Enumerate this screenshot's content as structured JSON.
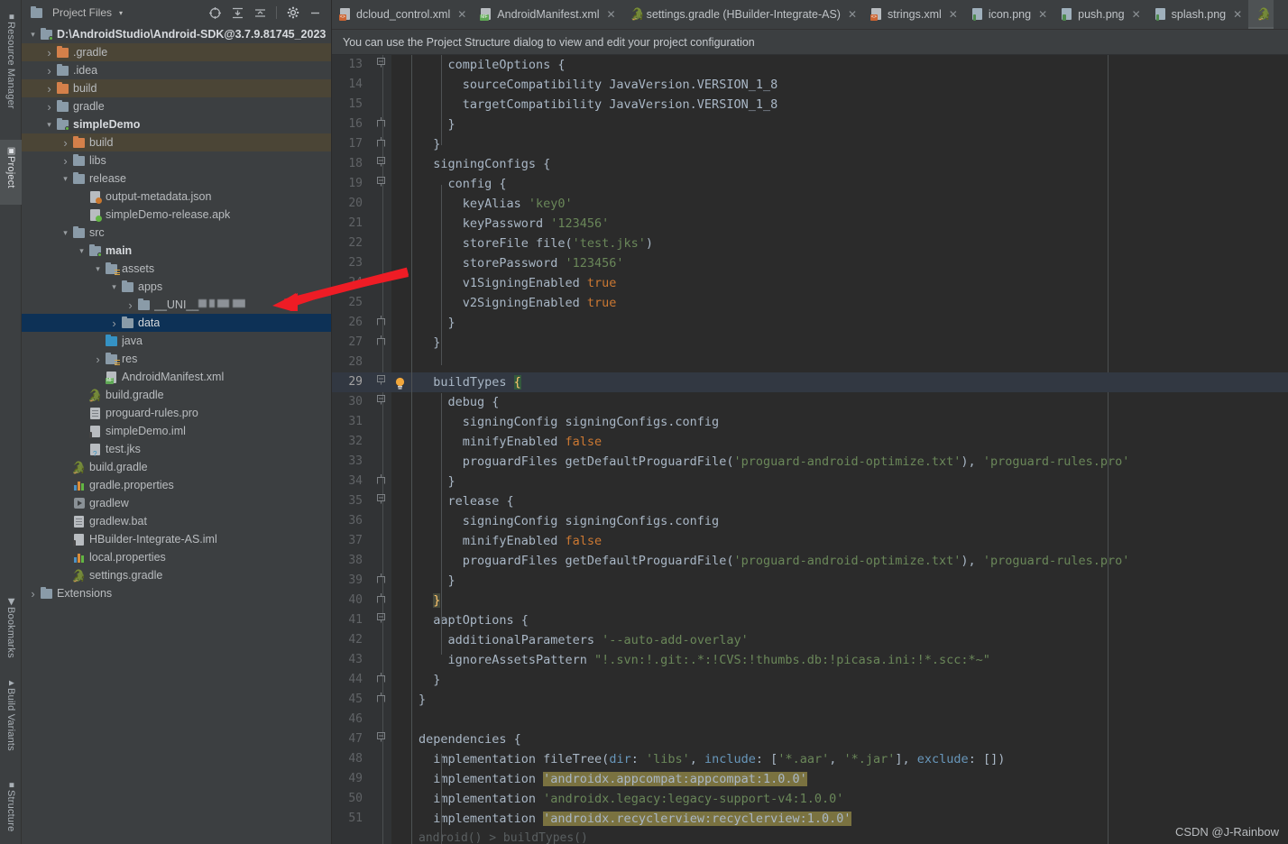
{
  "tool_windows_left": [
    {
      "label": "Resource Manager",
      "icon": "resource-manager-icon",
      "selected": false
    },
    {
      "label": "Project",
      "icon": "project-icon",
      "selected": true
    },
    {
      "label": "Bookmarks",
      "icon": "bookmarks-icon",
      "selected": false
    },
    {
      "label": "Build Variants",
      "icon": "build-variants-icon",
      "selected": false
    },
    {
      "label": "Structure",
      "icon": "structure-icon",
      "selected": false
    }
  ],
  "project_panel": {
    "title": "Project Files",
    "dropdown_caret": "▾",
    "tools": [
      {
        "name": "locate-in-tree-icon",
        "title": "Select Opened File"
      },
      {
        "name": "expand-all-icon",
        "title": "Expand All"
      },
      {
        "name": "collapse-all-icon",
        "title": "Collapse All"
      },
      {
        "name": "gear-icon",
        "title": "Settings"
      },
      {
        "name": "minimize-icon",
        "title": "Hide"
      }
    ],
    "tree": [
      {
        "label": "D:\\AndroidStudio\\Android-SDK@3.7.9.81745_2023",
        "indent": 0,
        "arrow": "down",
        "icon": "folder-module",
        "bold": true,
        "style": "normal"
      },
      {
        "label": ".gradle",
        "indent": 1,
        "arrow": "right",
        "icon": "folder-orange",
        "bold": false,
        "style": "tan"
      },
      {
        "label": ".idea",
        "indent": 1,
        "arrow": "right",
        "icon": "folder-grey",
        "bold": false,
        "style": "normal"
      },
      {
        "label": "build",
        "indent": 1,
        "arrow": "right",
        "icon": "folder-orange",
        "bold": false,
        "style": "tan"
      },
      {
        "label": "gradle",
        "indent": 1,
        "arrow": "right",
        "icon": "folder-grey",
        "bold": false,
        "style": "normal"
      },
      {
        "label": "simpleDemo",
        "indent": 1,
        "arrow": "down",
        "icon": "folder-module",
        "bold": true,
        "style": "normal"
      },
      {
        "label": "build",
        "indent": 2,
        "arrow": "right",
        "icon": "folder-orange",
        "bold": false,
        "style": "tan"
      },
      {
        "label": "libs",
        "indent": 2,
        "arrow": "right",
        "icon": "folder-grey",
        "bold": false,
        "style": "normal"
      },
      {
        "label": "release",
        "indent": 2,
        "arrow": "down",
        "icon": "folder-grey",
        "bold": false,
        "style": "normal"
      },
      {
        "label": "output-metadata.json",
        "indent": 3,
        "arrow": "none",
        "icon": "json-file",
        "bold": false,
        "style": "normal"
      },
      {
        "label": "simpleDemo-release.apk",
        "indent": 3,
        "arrow": "none",
        "icon": "apk-file",
        "bold": false,
        "style": "normal"
      },
      {
        "label": "src",
        "indent": 2,
        "arrow": "down",
        "icon": "folder-grey",
        "bold": false,
        "style": "normal"
      },
      {
        "label": "main",
        "indent": 3,
        "arrow": "down",
        "icon": "folder-module",
        "bold": true,
        "style": "normal"
      },
      {
        "label": "assets",
        "indent": 4,
        "arrow": "down",
        "icon": "folder-resource",
        "bold": false,
        "style": "normal"
      },
      {
        "label": "apps",
        "indent": 5,
        "arrow": "down",
        "icon": "folder-grey",
        "bold": false,
        "style": "normal"
      },
      {
        "label": "__UNI__",
        "indent": 6,
        "arrow": "right",
        "icon": "folder-grey",
        "bold": false,
        "style": "blurred"
      },
      {
        "label": "data",
        "indent": 5,
        "arrow": "right",
        "icon": "folder-grey",
        "bold": false,
        "style": "selected"
      },
      {
        "label": "java",
        "indent": 4,
        "arrow": "none",
        "icon": "folder-blue",
        "bold": false,
        "style": "normal"
      },
      {
        "label": "res",
        "indent": 4,
        "arrow": "right",
        "icon": "folder-resource",
        "bold": false,
        "style": "normal"
      },
      {
        "label": "AndroidManifest.xml",
        "indent": 4,
        "arrow": "none",
        "icon": "manifest-file",
        "bold": false,
        "style": "normal"
      },
      {
        "label": "build.gradle",
        "indent": 3,
        "arrow": "none",
        "icon": "gradle-file",
        "bold": false,
        "style": "normal"
      },
      {
        "label": "proguard-rules.pro",
        "indent": 3,
        "arrow": "none",
        "icon": "text-file",
        "bold": false,
        "style": "normal"
      },
      {
        "label": "simpleDemo.iml",
        "indent": 3,
        "arrow": "none",
        "icon": "iml-file",
        "bold": false,
        "style": "normal"
      },
      {
        "label": "test.jks",
        "indent": 3,
        "arrow": "none",
        "icon": "unknown-file",
        "bold": false,
        "style": "normal"
      },
      {
        "label": "build.gradle",
        "indent": 2,
        "arrow": "none",
        "icon": "gradle-file",
        "bold": false,
        "style": "normal"
      },
      {
        "label": "gradle.properties",
        "indent": 2,
        "arrow": "none",
        "icon": "properties-file",
        "bold": false,
        "style": "normal"
      },
      {
        "label": "gradlew",
        "indent": 2,
        "arrow": "none",
        "icon": "script-file",
        "bold": false,
        "style": "normal"
      },
      {
        "label": "gradlew.bat",
        "indent": 2,
        "arrow": "none",
        "icon": "text-file",
        "bold": false,
        "style": "normal"
      },
      {
        "label": "HBuilder-Integrate-AS.iml",
        "indent": 2,
        "arrow": "none",
        "icon": "iml-file",
        "bold": false,
        "style": "normal"
      },
      {
        "label": "local.properties",
        "indent": 2,
        "arrow": "none",
        "icon": "properties-file",
        "bold": false,
        "style": "normal"
      },
      {
        "label": "settings.gradle",
        "indent": 2,
        "arrow": "none",
        "icon": "gradle-file",
        "bold": false,
        "style": "normal"
      },
      {
        "label": "Extensions",
        "indent": 0,
        "arrow": "right",
        "icon": "folder-grey",
        "bold": false,
        "style": "normal"
      }
    ]
  },
  "editor": {
    "tabs": [
      {
        "label": "dcloud_control.xml",
        "icon": "xml-file-icon",
        "active": false,
        "closable": true
      },
      {
        "label": "AndroidManifest.xml",
        "icon": "manifest-file-icon",
        "active": false,
        "closable": true
      },
      {
        "label": "settings.gradle (HBuilder-Integrate-AS)",
        "icon": "gradle-file-icon",
        "active": false,
        "closable": true
      },
      {
        "label": "strings.xml",
        "icon": "xml-file-icon",
        "active": false,
        "closable": true
      },
      {
        "label": "icon.png",
        "icon": "image-file-icon",
        "active": false,
        "closable": true
      },
      {
        "label": "push.png",
        "icon": "image-file-icon",
        "active": false,
        "closable": true
      },
      {
        "label": "splash.png",
        "icon": "image-file-icon",
        "active": false,
        "closable": true
      },
      {
        "label": "",
        "icon": "gradle-file-icon",
        "active": true,
        "closable": false
      }
    ],
    "notification": "You can use the Project Structure dialog to view and edit your project configuration",
    "breadcrumb": "android() > buildTypes()",
    "first_line_number": 13,
    "lines": [
      {
        "n": 13,
        "fold": "fold-start",
        "indent": 4,
        "tokens": [
          {
            "t": "compileOptions {",
            "c": "pln"
          }
        ]
      },
      {
        "n": 14,
        "fold": "",
        "indent": 6,
        "tokens": [
          {
            "t": "sourceCompatibility JavaVersion.VERSION_1_8",
            "c": "pln"
          }
        ]
      },
      {
        "n": 15,
        "fold": "",
        "indent": 6,
        "tokens": [
          {
            "t": "targetCompatibility JavaVersion.VERSION_1_8",
            "c": "pln"
          }
        ]
      },
      {
        "n": 16,
        "fold": "fold-end",
        "indent": 4,
        "tokens": [
          {
            "t": "}",
            "c": "pln"
          }
        ]
      },
      {
        "n": 17,
        "fold": "fold-end",
        "indent": 2,
        "tokens": [
          {
            "t": "}",
            "c": "pln"
          }
        ]
      },
      {
        "n": 18,
        "fold": "fold-start",
        "indent": 2,
        "tokens": [
          {
            "t": "signingConfigs {",
            "c": "pln"
          }
        ]
      },
      {
        "n": 19,
        "fold": "fold-start",
        "indent": 4,
        "tokens": [
          {
            "t": "config {",
            "c": "pln"
          }
        ]
      },
      {
        "n": 20,
        "fold": "",
        "indent": 6,
        "tokens": [
          {
            "t": "keyAlias ",
            "c": "pln"
          },
          {
            "t": "'key0'",
            "c": "s"
          }
        ]
      },
      {
        "n": 21,
        "fold": "",
        "indent": 6,
        "tokens": [
          {
            "t": "keyPassword ",
            "c": "pln"
          },
          {
            "t": "'123456'",
            "c": "s"
          }
        ]
      },
      {
        "n": 22,
        "fold": "",
        "indent": 6,
        "tokens": [
          {
            "t": "storeFile file(",
            "c": "pln"
          },
          {
            "t": "'test.jks'",
            "c": "s"
          },
          {
            "t": ")",
            "c": "pln"
          }
        ]
      },
      {
        "n": 23,
        "fold": "",
        "indent": 6,
        "tokens": [
          {
            "t": "storePassword ",
            "c": "pln"
          },
          {
            "t": "'123456'",
            "c": "s"
          }
        ]
      },
      {
        "n": 24,
        "fold": "",
        "indent": 6,
        "tokens": [
          {
            "t": "v1SigningEnabled ",
            "c": "pln"
          },
          {
            "t": "true",
            "c": "k"
          }
        ]
      },
      {
        "n": 25,
        "fold": "",
        "indent": 6,
        "tokens": [
          {
            "t": "v2SigningEnabled ",
            "c": "pln"
          },
          {
            "t": "true",
            "c": "k"
          }
        ]
      },
      {
        "n": 26,
        "fold": "fold-end",
        "indent": 4,
        "tokens": [
          {
            "t": "}",
            "c": "pln"
          }
        ]
      },
      {
        "n": 27,
        "fold": "fold-end",
        "indent": 2,
        "tokens": [
          {
            "t": "}",
            "c": "pln"
          }
        ]
      },
      {
        "n": 28,
        "fold": "",
        "indent": 0,
        "tokens": []
      },
      {
        "n": 29,
        "fold": "fold-start",
        "indent": 2,
        "bulb": true,
        "highlight": true,
        "tokens": [
          {
            "t": "buildTypes ",
            "c": "pln"
          },
          {
            "t": "{",
            "c": "hlb"
          }
        ]
      },
      {
        "n": 30,
        "fold": "fold-start",
        "indent": 4,
        "tokens": [
          {
            "t": "debug {",
            "c": "pln"
          }
        ]
      },
      {
        "n": 31,
        "fold": "",
        "indent": 6,
        "tokens": [
          {
            "t": "signingConfig signingConfigs.config",
            "c": "pln"
          }
        ]
      },
      {
        "n": 32,
        "fold": "",
        "indent": 6,
        "tokens": [
          {
            "t": "minifyEnabled ",
            "c": "pln"
          },
          {
            "t": "false",
            "c": "k"
          }
        ]
      },
      {
        "n": 33,
        "fold": "",
        "indent": 6,
        "tokens": [
          {
            "t": "proguardFiles getDefaultProguardFile(",
            "c": "pln"
          },
          {
            "t": "'proguard-android-optimize.txt'",
            "c": "s"
          },
          {
            "t": "), ",
            "c": "pln"
          },
          {
            "t": "'proguard-rules.pro'",
            "c": "s"
          }
        ]
      },
      {
        "n": 34,
        "fold": "fold-end",
        "indent": 4,
        "tokens": [
          {
            "t": "}",
            "c": "pln"
          }
        ]
      },
      {
        "n": 35,
        "fold": "fold-start",
        "indent": 4,
        "tokens": [
          {
            "t": "release {",
            "c": "pln"
          }
        ]
      },
      {
        "n": 36,
        "fold": "",
        "indent": 6,
        "tokens": [
          {
            "t": "signingConfig signingConfigs.config",
            "c": "pln"
          }
        ]
      },
      {
        "n": 37,
        "fold": "",
        "indent": 6,
        "tokens": [
          {
            "t": "minifyEnabled ",
            "c": "pln"
          },
          {
            "t": "false",
            "c": "k"
          }
        ]
      },
      {
        "n": 38,
        "fold": "",
        "indent": 6,
        "tokens": [
          {
            "t": "proguardFiles getDefaultProguardFile(",
            "c": "pln"
          },
          {
            "t": "'proguard-android-optimize.txt'",
            "c": "s"
          },
          {
            "t": "), ",
            "c": "pln"
          },
          {
            "t": "'proguard-rules.pro'",
            "c": "s"
          }
        ]
      },
      {
        "n": 39,
        "fold": "fold-end",
        "indent": 4,
        "tokens": [
          {
            "t": "}",
            "c": "pln"
          }
        ]
      },
      {
        "n": 40,
        "fold": "fold-end",
        "indent": 2,
        "tokens": [
          {
            "t": "}",
            "c": "hly"
          }
        ]
      },
      {
        "n": 41,
        "fold": "fold-start",
        "indent": 2,
        "tokens": [
          {
            "t": "aaptOptions {",
            "c": "pln"
          }
        ]
      },
      {
        "n": 42,
        "fold": "",
        "indent": 4,
        "tokens": [
          {
            "t": "additionalParameters ",
            "c": "pln"
          },
          {
            "t": "'--auto-add-overlay'",
            "c": "s"
          }
        ]
      },
      {
        "n": 43,
        "fold": "",
        "indent": 4,
        "tokens": [
          {
            "t": "ignoreAssetsPattern ",
            "c": "pln"
          },
          {
            "t": "\"!.svn:!.git:.*:!CVS:!thumbs.db:!picasa.ini:!*.scc:*~\"",
            "c": "s"
          }
        ]
      },
      {
        "n": 44,
        "fold": "fold-end",
        "indent": 2,
        "tokens": [
          {
            "t": "}",
            "c": "pln"
          }
        ]
      },
      {
        "n": 45,
        "fold": "fold-end",
        "indent": 0,
        "tokens": [
          {
            "t": "}",
            "c": "pln"
          }
        ]
      },
      {
        "n": 46,
        "fold": "",
        "indent": 0,
        "tokens": []
      },
      {
        "n": 47,
        "fold": "fold-start",
        "indent": 0,
        "tokens": [
          {
            "t": "dependencies {",
            "c": "pln"
          }
        ]
      },
      {
        "n": 48,
        "fold": "",
        "indent": 2,
        "tokens": [
          {
            "t": "implementation fileTree(",
            "c": "pln"
          },
          {
            "t": "dir",
            "c": "n"
          },
          {
            "t": ": ",
            "c": "pln"
          },
          {
            "t": "'libs'",
            "c": "s"
          },
          {
            "t": ", ",
            "c": "pln"
          },
          {
            "t": "include",
            "c": "n"
          },
          {
            "t": ": [",
            "c": "pln"
          },
          {
            "t": "'*.aar'",
            "c": "s"
          },
          {
            "t": ", ",
            "c": "pln"
          },
          {
            "t": "'*.jar'",
            "c": "s"
          },
          {
            "t": "], ",
            "c": "pln"
          },
          {
            "t": "exclude",
            "c": "n"
          },
          {
            "t": ": [])",
            "c": "pln"
          }
        ]
      },
      {
        "n": 49,
        "fold": "",
        "indent": 2,
        "tokens": [
          {
            "t": "implementation ",
            "c": "pln"
          },
          {
            "t": "'androidx.appcompat:appcompat:1.0.0'",
            "c": "occ"
          }
        ]
      },
      {
        "n": 50,
        "fold": "",
        "indent": 2,
        "tokens": [
          {
            "t": "implementation ",
            "c": "pln"
          },
          {
            "t": "'androidx.legacy:legacy-support-v4:1.0.0'",
            "c": "s"
          }
        ]
      },
      {
        "n": 51,
        "fold": "",
        "indent": 2,
        "tokens": [
          {
            "t": "implementation ",
            "c": "pln"
          },
          {
            "t": "'androidx.recyclerview:recyclerview:1.0.0'",
            "c": "occ"
          }
        ]
      }
    ]
  },
  "annotation": {
    "type": "red-arrow",
    "color": "#ee1c25"
  },
  "watermark": "CSDN @J-Rainbow",
  "colors": {
    "panel_bg": "#3c3f41",
    "editor_bg": "#2b2b2b",
    "gutter_bg": "#313335",
    "selection": "#0d3156",
    "tan_row": "#4b4536",
    "string_green": "#6a8759",
    "keyword_orange": "#cc7832",
    "number_blue": "#6897bb",
    "usage_olive": "#7a7240",
    "accent_red": "#ee1c25"
  }
}
